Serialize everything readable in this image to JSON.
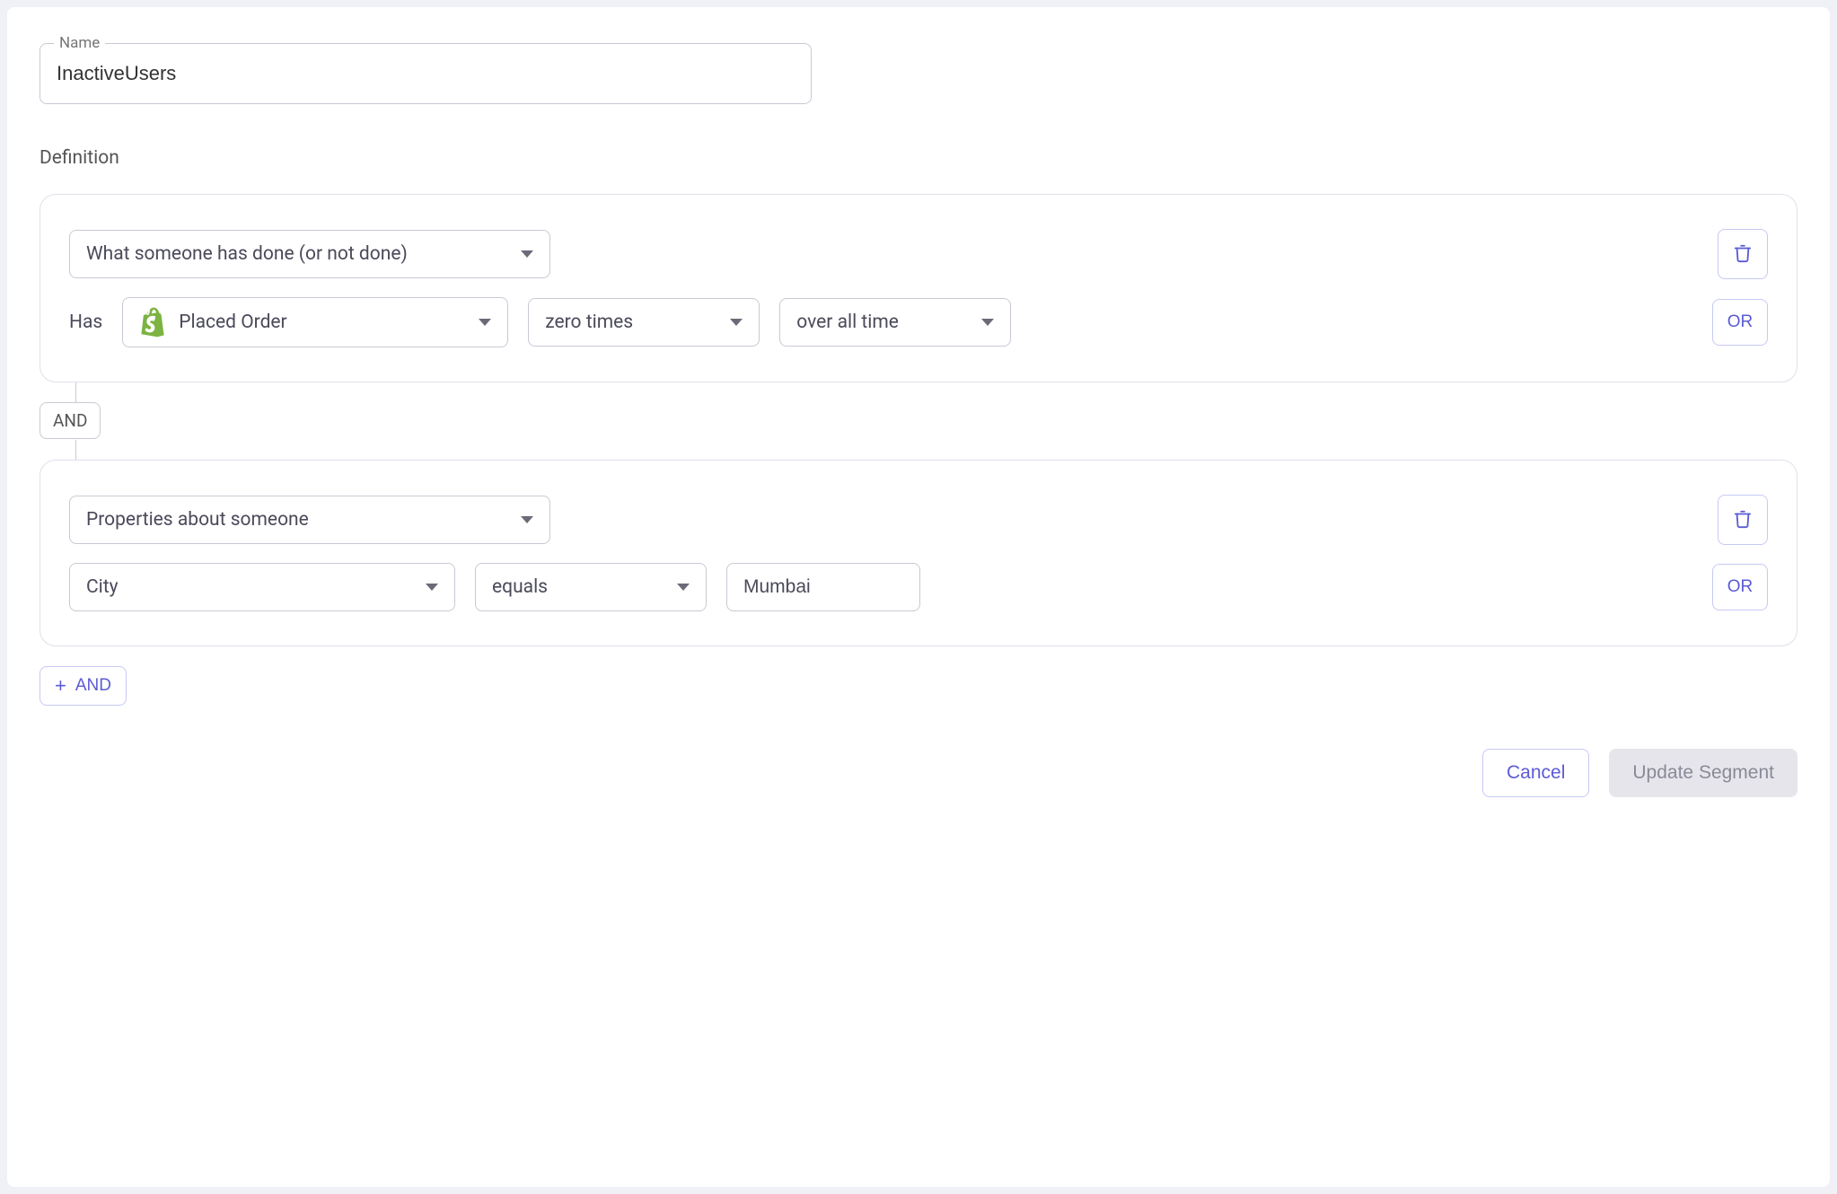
{
  "name_field": {
    "legend": "Name",
    "value": "InactiveUsers"
  },
  "definition_label": "Definition",
  "conditions": [
    {
      "type_select": "What someone has done (or not done)",
      "has_label": "Has",
      "event": "Placed Order",
      "event_icon": "shopify-icon",
      "times_select": "zero times",
      "range_select": "over all time",
      "or_label": "OR"
    },
    {
      "type_select": "Properties about someone",
      "property_select": "City",
      "operator_select": "equals",
      "value": "Mumbai",
      "or_label": "OR"
    }
  ],
  "connector": "AND",
  "add_and_label": "AND",
  "footer": {
    "cancel": "Cancel",
    "update": "Update Segment"
  }
}
